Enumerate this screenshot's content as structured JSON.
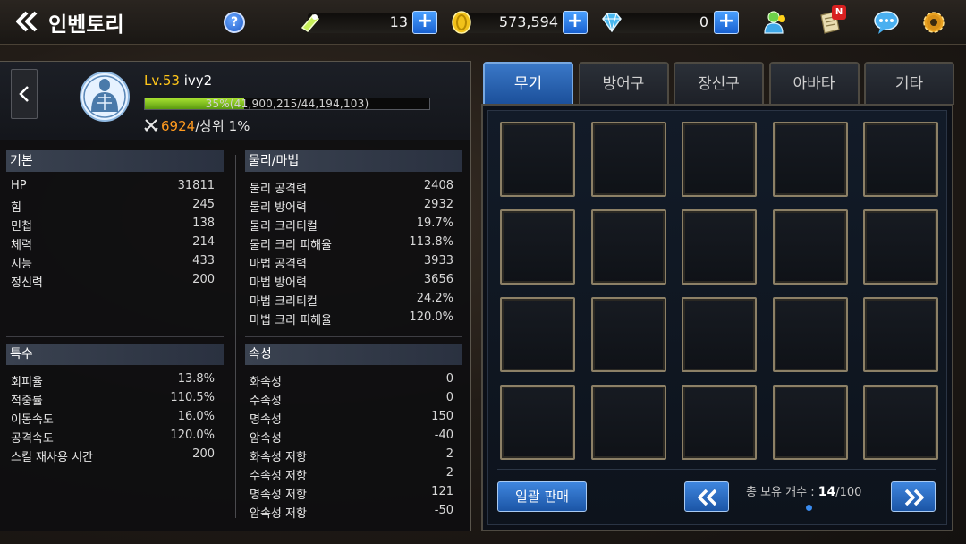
{
  "header": {
    "title": "인벤토리",
    "help": "?",
    "currency": [
      {
        "icon": "energy-icon",
        "value": "13"
      },
      {
        "icon": "gold-coin-icon",
        "value": "573,594"
      },
      {
        "icon": "gem-icon",
        "value": "0"
      }
    ],
    "notification_badge": "N"
  },
  "character": {
    "level": "Lv.53",
    "name": "ivy2",
    "exp_text": "35%(41,900,215/44,194,103)",
    "exp_percent": 35,
    "power": "6924",
    "rank": "/상위 1%"
  },
  "sections": {
    "basic": {
      "title": "기본",
      "rows": [
        {
          "k": "HP",
          "v": "31811"
        },
        {
          "k": "힘",
          "v": "245"
        },
        {
          "k": "민첩",
          "v": "138"
        },
        {
          "k": "체력",
          "v": "214"
        },
        {
          "k": "지능",
          "v": "433"
        },
        {
          "k": "정신력",
          "v": "200"
        }
      ]
    },
    "physmag": {
      "title": "물리/마법",
      "rows": [
        {
          "k": "물리 공격력",
          "v": "2408"
        },
        {
          "k": "물리 방어력",
          "v": "2932"
        },
        {
          "k": "물리 크리티컬",
          "v": "19.7%"
        },
        {
          "k": "물리 크리 피해율",
          "v": "113.8%"
        },
        {
          "k": "마법 공격력",
          "v": "3933"
        },
        {
          "k": "마법 방어력",
          "v": "3656"
        },
        {
          "k": "마법 크리티컬",
          "v": "24.2%"
        },
        {
          "k": "마법 크리 피해율",
          "v": "120.0%"
        }
      ]
    },
    "special": {
      "title": "특수",
      "rows": [
        {
          "k": "회피율",
          "v": "13.8%"
        },
        {
          "k": "적중률",
          "v": "110.5%"
        },
        {
          "k": "이동속도",
          "v": "16.0%"
        },
        {
          "k": "공격속도",
          "v": "120.0%"
        },
        {
          "k": "스킬 재사용 시간",
          "v": "200"
        }
      ]
    },
    "element": {
      "title": "속성",
      "rows": [
        {
          "k": "화속성",
          "v": "0"
        },
        {
          "k": "수속성",
          "v": "0"
        },
        {
          "k": "명속성",
          "v": "150"
        },
        {
          "k": "암속성",
          "v": "-40"
        },
        {
          "k": "화속성 저항",
          "v": "2"
        },
        {
          "k": "수속성 저항",
          "v": "2"
        },
        {
          "k": "명속성 저항",
          "v": "121"
        },
        {
          "k": "암속성 저항",
          "v": "-50"
        }
      ]
    }
  },
  "tabs": [
    "무기",
    "방어구",
    "장신구",
    "아바타",
    "기타"
  ],
  "active_tab": 0,
  "inventory": {
    "slot_rows": 4,
    "slot_cols": 5,
    "bulk_sell": "일괄 판매",
    "count_label": "총 보유 개수 : ",
    "count_current": "14",
    "count_max": "/100"
  },
  "colors": {
    "accent_blue": "#1f6fd6",
    "level_yellow": "#ffc61a",
    "power_orange": "#ff9a1f",
    "exp_green": "#8cd020"
  }
}
